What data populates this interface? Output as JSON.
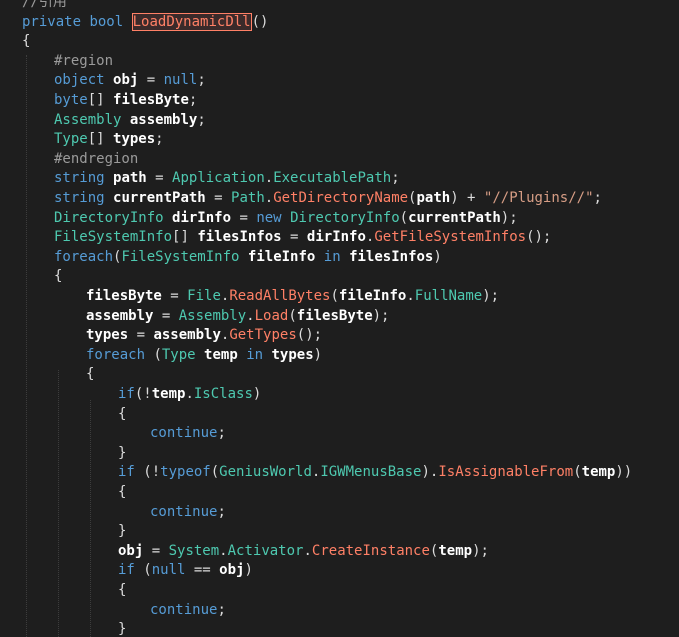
{
  "colors": {
    "background": "#1e1e1e",
    "keyword": "#569cd6",
    "type": "#4ec9b0",
    "method": "#ff8066",
    "variable": "#ffffff",
    "preprocessor": "#9b9b9b",
    "string": "#d69d85"
  },
  "lines": [
    {
      "indent": 0,
      "tokens": [
        {
          "t": "//引用",
          "c": "preproc"
        }
      ]
    },
    {
      "indent": 0,
      "tokens": [
        {
          "t": "private",
          "c": "kw"
        },
        {
          "t": " ",
          "c": "plain"
        },
        {
          "t": "bool",
          "c": "kw"
        },
        {
          "t": " ",
          "c": "plain"
        },
        {
          "t": "LoadDynamicDll",
          "c": "method",
          "hl": true
        },
        {
          "t": "()",
          "c": "punct"
        }
      ]
    },
    {
      "indent": 0,
      "tokens": [
        {
          "t": "{",
          "c": "punct"
        }
      ]
    },
    {
      "indent": 1,
      "tokens": [
        {
          "t": "#region",
          "c": "preproc"
        }
      ]
    },
    {
      "indent": 1,
      "tokens": [
        {
          "t": "object",
          "c": "kw"
        },
        {
          "t": " ",
          "c": "plain"
        },
        {
          "t": "obj",
          "c": "var"
        },
        {
          "t": " = ",
          "c": "plain"
        },
        {
          "t": "null",
          "c": "kw"
        },
        {
          "t": ";",
          "c": "punct"
        }
      ]
    },
    {
      "indent": 1,
      "tokens": [
        {
          "t": "byte",
          "c": "kw"
        },
        {
          "t": "[] ",
          "c": "punct"
        },
        {
          "t": "filesByte",
          "c": "var"
        },
        {
          "t": ";",
          "c": "punct"
        }
      ]
    },
    {
      "indent": 1,
      "tokens": [
        {
          "t": "Assembly",
          "c": "type"
        },
        {
          "t": " ",
          "c": "plain"
        },
        {
          "t": "assembly",
          "c": "var"
        },
        {
          "t": ";",
          "c": "punct"
        }
      ]
    },
    {
      "indent": 1,
      "tokens": [
        {
          "t": "Type",
          "c": "type"
        },
        {
          "t": "[] ",
          "c": "punct"
        },
        {
          "t": "types",
          "c": "var"
        },
        {
          "t": ";",
          "c": "punct"
        }
      ]
    },
    {
      "indent": 1,
      "tokens": [
        {
          "t": "#endregion",
          "c": "preproc"
        }
      ]
    },
    {
      "indent": 1,
      "tokens": [
        {
          "t": "string",
          "c": "kw"
        },
        {
          "t": " ",
          "c": "plain"
        },
        {
          "t": "path",
          "c": "var"
        },
        {
          "t": " = ",
          "c": "plain"
        },
        {
          "t": "Application",
          "c": "type"
        },
        {
          "t": ".",
          "c": "punct"
        },
        {
          "t": "ExecutablePath",
          "c": "type"
        },
        {
          "t": ";",
          "c": "punct"
        }
      ]
    },
    {
      "indent": 1,
      "tokens": [
        {
          "t": "string",
          "c": "kw"
        },
        {
          "t": " ",
          "c": "plain"
        },
        {
          "t": "currentPath",
          "c": "var"
        },
        {
          "t": " = ",
          "c": "plain"
        },
        {
          "t": "Path",
          "c": "type"
        },
        {
          "t": ".",
          "c": "punct"
        },
        {
          "t": "GetDirectoryName",
          "c": "method"
        },
        {
          "t": "(",
          "c": "punct"
        },
        {
          "t": "path",
          "c": "var"
        },
        {
          "t": ") + ",
          "c": "punct"
        },
        {
          "t": "\"//Plugins//\"",
          "c": "str"
        },
        {
          "t": ";",
          "c": "punct"
        }
      ]
    },
    {
      "indent": 1,
      "tokens": [
        {
          "t": "DirectoryInfo",
          "c": "type"
        },
        {
          "t": " ",
          "c": "plain"
        },
        {
          "t": "dirInfo",
          "c": "var"
        },
        {
          "t": " = ",
          "c": "plain"
        },
        {
          "t": "new",
          "c": "kw"
        },
        {
          "t": " ",
          "c": "plain"
        },
        {
          "t": "DirectoryInfo",
          "c": "type"
        },
        {
          "t": "(",
          "c": "punct"
        },
        {
          "t": "currentPath",
          "c": "var"
        },
        {
          "t": ");",
          "c": "punct"
        }
      ]
    },
    {
      "indent": 1,
      "tokens": [
        {
          "t": "FileSystemInfo",
          "c": "type"
        },
        {
          "t": "[] ",
          "c": "punct"
        },
        {
          "t": "filesInfos",
          "c": "var"
        },
        {
          "t": " = ",
          "c": "plain"
        },
        {
          "t": "dirInfo",
          "c": "var"
        },
        {
          "t": ".",
          "c": "punct"
        },
        {
          "t": "GetFileSystemInfos",
          "c": "method"
        },
        {
          "t": "();",
          "c": "punct"
        }
      ]
    },
    {
      "indent": 1,
      "tokens": [
        {
          "t": "foreach",
          "c": "kw"
        },
        {
          "t": "(",
          "c": "punct"
        },
        {
          "t": "FileSystemInfo",
          "c": "type"
        },
        {
          "t": " ",
          "c": "plain"
        },
        {
          "t": "fileInfo",
          "c": "var"
        },
        {
          "t": " ",
          "c": "plain"
        },
        {
          "t": "in",
          "c": "kw"
        },
        {
          "t": " ",
          "c": "plain"
        },
        {
          "t": "filesInfos",
          "c": "var"
        },
        {
          "t": ")",
          "c": "punct"
        }
      ]
    },
    {
      "indent": 1,
      "tokens": [
        {
          "t": "{",
          "c": "punct"
        }
      ]
    },
    {
      "indent": 2,
      "tokens": [
        {
          "t": "filesByte",
          "c": "var"
        },
        {
          "t": " = ",
          "c": "plain"
        },
        {
          "t": "File",
          "c": "type"
        },
        {
          "t": ".",
          "c": "punct"
        },
        {
          "t": "ReadAllBytes",
          "c": "method"
        },
        {
          "t": "(",
          "c": "punct"
        },
        {
          "t": "fileInfo",
          "c": "var"
        },
        {
          "t": ".",
          "c": "punct"
        },
        {
          "t": "FullName",
          "c": "type"
        },
        {
          "t": ");",
          "c": "punct"
        }
      ]
    },
    {
      "indent": 2,
      "tokens": [
        {
          "t": "assembly",
          "c": "var"
        },
        {
          "t": " = ",
          "c": "plain"
        },
        {
          "t": "Assembly",
          "c": "type"
        },
        {
          "t": ".",
          "c": "punct"
        },
        {
          "t": "Load",
          "c": "method"
        },
        {
          "t": "(",
          "c": "punct"
        },
        {
          "t": "filesByte",
          "c": "var"
        },
        {
          "t": ");",
          "c": "punct"
        }
      ]
    },
    {
      "indent": 2,
      "tokens": [
        {
          "t": "types",
          "c": "var"
        },
        {
          "t": " = ",
          "c": "plain"
        },
        {
          "t": "assembly",
          "c": "var"
        },
        {
          "t": ".",
          "c": "punct"
        },
        {
          "t": "GetTypes",
          "c": "method"
        },
        {
          "t": "();",
          "c": "punct"
        }
      ]
    },
    {
      "indent": 2,
      "tokens": [
        {
          "t": "foreach",
          "c": "kw"
        },
        {
          "t": " (",
          "c": "punct"
        },
        {
          "t": "Type",
          "c": "type"
        },
        {
          "t": " ",
          "c": "plain"
        },
        {
          "t": "temp",
          "c": "var"
        },
        {
          "t": " ",
          "c": "plain"
        },
        {
          "t": "in",
          "c": "kw"
        },
        {
          "t": " ",
          "c": "plain"
        },
        {
          "t": "types",
          "c": "var"
        },
        {
          "t": ")",
          "c": "punct"
        }
      ]
    },
    {
      "indent": 2,
      "tokens": [
        {
          "t": "{",
          "c": "punct"
        }
      ]
    },
    {
      "indent": 3,
      "tokens": [
        {
          "t": "if",
          "c": "kw"
        },
        {
          "t": "(!",
          "c": "punct"
        },
        {
          "t": "temp",
          "c": "var"
        },
        {
          "t": ".",
          "c": "punct"
        },
        {
          "t": "IsClass",
          "c": "type"
        },
        {
          "t": ")",
          "c": "punct"
        }
      ]
    },
    {
      "indent": 3,
      "tokens": [
        {
          "t": "{",
          "c": "punct"
        }
      ]
    },
    {
      "indent": 4,
      "tokens": [
        {
          "t": "continue",
          "c": "kw"
        },
        {
          "t": ";",
          "c": "punct"
        }
      ]
    },
    {
      "indent": 3,
      "tokens": [
        {
          "t": "}",
          "c": "punct"
        }
      ]
    },
    {
      "indent": 3,
      "tokens": [
        {
          "t": "if",
          "c": "kw"
        },
        {
          "t": " (!",
          "c": "punct"
        },
        {
          "t": "typeof",
          "c": "kw"
        },
        {
          "t": "(",
          "c": "punct"
        },
        {
          "t": "GeniusWorld",
          "c": "type"
        },
        {
          "t": ".",
          "c": "punct"
        },
        {
          "t": "IGWMenusBase",
          "c": "type"
        },
        {
          "t": ").",
          "c": "punct"
        },
        {
          "t": "IsAssignableFrom",
          "c": "method"
        },
        {
          "t": "(",
          "c": "punct"
        },
        {
          "t": "temp",
          "c": "var"
        },
        {
          "t": "))",
          "c": "punct"
        }
      ]
    },
    {
      "indent": 3,
      "tokens": [
        {
          "t": "{",
          "c": "punct"
        }
      ]
    },
    {
      "indent": 4,
      "tokens": [
        {
          "t": "continue",
          "c": "kw"
        },
        {
          "t": ";",
          "c": "punct"
        }
      ]
    },
    {
      "indent": 3,
      "tokens": [
        {
          "t": "}",
          "c": "punct"
        }
      ]
    },
    {
      "indent": 3,
      "tokens": [
        {
          "t": "obj",
          "c": "var"
        },
        {
          "t": " = ",
          "c": "plain"
        },
        {
          "t": "System",
          "c": "type"
        },
        {
          "t": ".",
          "c": "punct"
        },
        {
          "t": "Activator",
          "c": "type"
        },
        {
          "t": ".",
          "c": "punct"
        },
        {
          "t": "CreateInstance",
          "c": "method"
        },
        {
          "t": "(",
          "c": "punct"
        },
        {
          "t": "temp",
          "c": "var"
        },
        {
          "t": ");",
          "c": "punct"
        }
      ]
    },
    {
      "indent": 3,
      "tokens": [
        {
          "t": "if",
          "c": "kw"
        },
        {
          "t": " (",
          "c": "punct"
        },
        {
          "t": "null",
          "c": "kw"
        },
        {
          "t": " == ",
          "c": "plain"
        },
        {
          "t": "obj",
          "c": "var"
        },
        {
          "t": ")",
          "c": "punct"
        }
      ]
    },
    {
      "indent": 3,
      "tokens": [
        {
          "t": "{",
          "c": "punct"
        }
      ]
    },
    {
      "indent": 4,
      "tokens": [
        {
          "t": "continue",
          "c": "kw"
        },
        {
          "t": ";",
          "c": "punct"
        }
      ]
    },
    {
      "indent": 3,
      "tokens": [
        {
          "t": "}",
          "c": "punct"
        }
      ]
    }
  ]
}
